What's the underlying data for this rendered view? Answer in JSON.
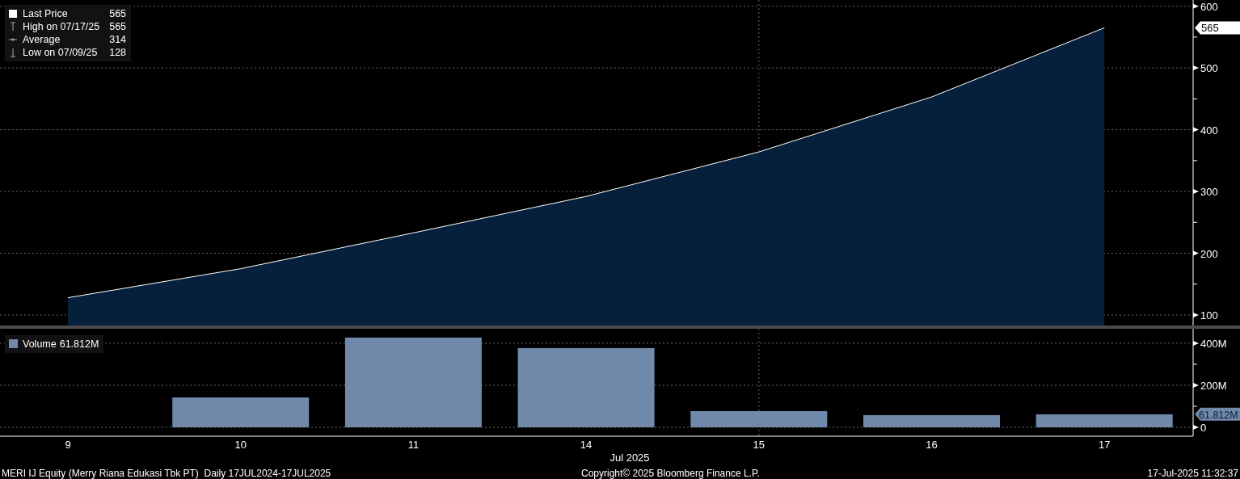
{
  "price_panel": {
    "legend": [
      {
        "kind": "last",
        "value": "565"
      },
      {
        "kind": "high",
        "label": "High on 07/17/25",
        "value": "565"
      },
      {
        "kind": "average",
        "label": "Average",
        "value": "314"
      },
      {
        "kind": "low",
        "label": "Low on 07/09/25",
        "value": "128"
      }
    ],
    "last_tag": "565",
    "chart_data": {
      "type": "area",
      "grid": true,
      "series": [
        {
          "name": "Last Price",
          "color": "#ffffff",
          "values": [
            128,
            175,
            233,
            292,
            364,
            453,
            565
          ]
        }
      ],
      "ylim": [
        83,
        610
      ],
      "yticks": [
        100,
        200,
        300,
        400,
        500,
        600
      ]
    }
  },
  "volume_panel": {
    "legend": {
      "value": "61.812M"
    },
    "last_tag": "61.812M",
    "chart_data": {
      "type": "bar",
      "grid": true,
      "categories": [
        "9",
        "10",
        "11",
        "14",
        "15",
        "16",
        "17"
      ],
      "xlabel": "Jul 2025",
      "series": [
        {
          "name": "Volume",
          "color": "#7089aa",
          "values": [
            null,
            142,
            427,
            377,
            77,
            58,
            62
          ]
        }
      ],
      "ylim": [
        0,
        469
      ],
      "yticks": [
        {
          "value": 0,
          "label": "0"
        },
        {
          "value": 200,
          "label": "200M"
        },
        {
          "value": 400,
          "label": "400M"
        }
      ]
    }
  },
  "footer": {
    "security": "MERI IJ Equity (Merry Riana Edukasi Tbk PT)  Daily 17JUL2024-17JUL2025",
    "copyright": "Copyright© 2025 Bloomberg Finance L.P.",
    "timestamp": "17-Jul-2025 11:32:37"
  }
}
